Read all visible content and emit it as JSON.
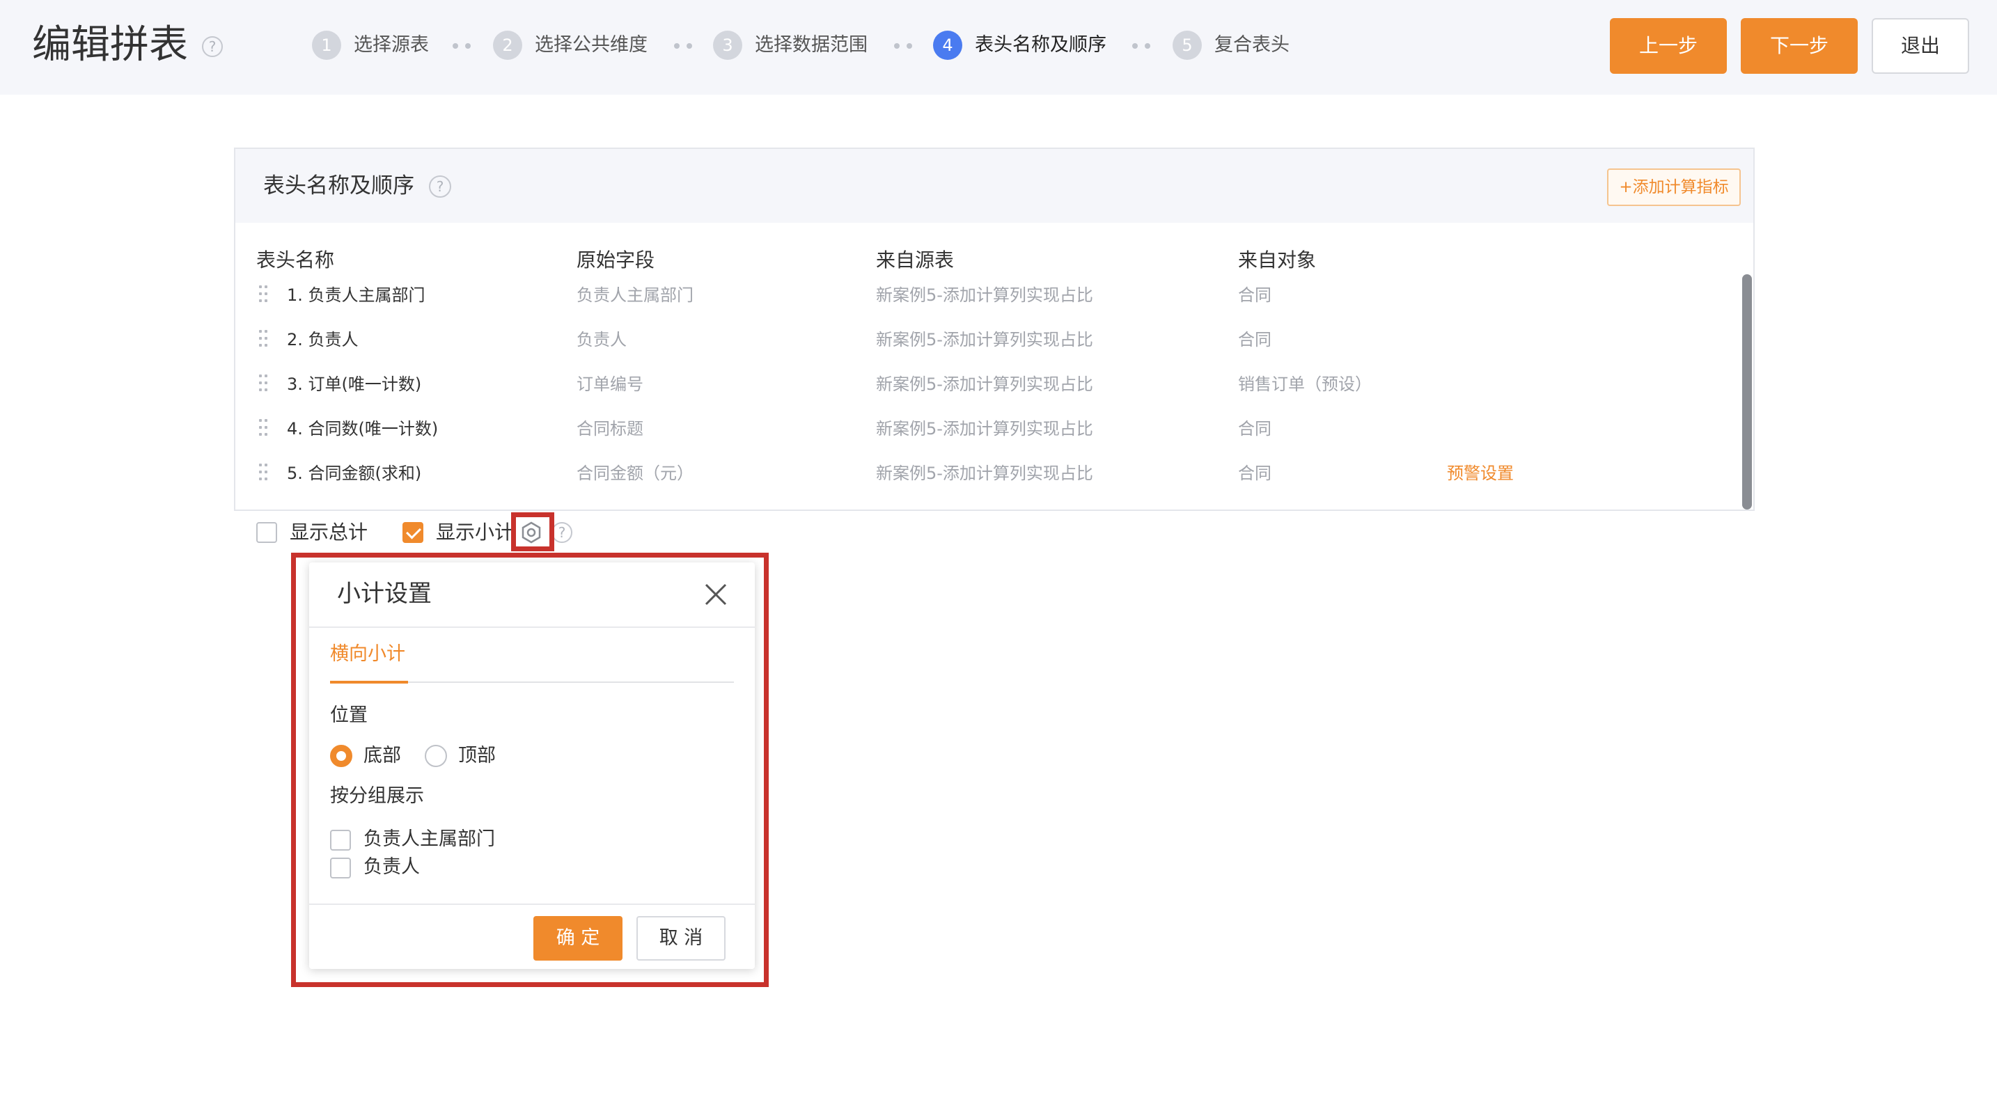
{
  "header": {
    "title": "编辑拼表",
    "help_icon": "?",
    "steps": [
      {
        "num": "1",
        "label": "选择源表",
        "active": false
      },
      {
        "num": "2",
        "label": "选择公共维度",
        "active": false
      },
      {
        "num": "3",
        "label": "选择数据范围",
        "active": false
      },
      {
        "num": "4",
        "label": "表头名称及顺序",
        "active": true
      },
      {
        "num": "5",
        "label": "复合表头",
        "active": false
      }
    ],
    "prev_label": "上一步",
    "next_label": "下一步",
    "exit_label": "退出"
  },
  "card": {
    "title": "表头名称及顺序",
    "help_icon": "?",
    "add_metric_label": "+添加计算指标",
    "columns": [
      "表头名称",
      "原始字段",
      "来自源表",
      "来自对象"
    ],
    "rows": [
      {
        "name": "1. 负责人主属部门",
        "field": "负责人主属部门",
        "source": "新案例5-添加计算列实现占比",
        "object": "合同",
        "action": ""
      },
      {
        "name": "2. 负责人",
        "field": "负责人",
        "source": "新案例5-添加计算列实现占比",
        "object": "合同",
        "action": ""
      },
      {
        "name": "3. 订单(唯一计数)",
        "field": "订单编号",
        "source": "新案例5-添加计算列实现占比",
        "object": "销售订单（预设）",
        "action": ""
      },
      {
        "name": "4. 合同数(唯一计数)",
        "field": "合同标题",
        "source": "新案例5-添加计算列实现占比",
        "object": "合同",
        "action": ""
      },
      {
        "name": "5. 合同金额(求和)",
        "field": "合同金额（元）",
        "source": "新案例5-添加计算列实现占比",
        "object": "合同",
        "action": "预警设置"
      }
    ]
  },
  "options": {
    "show_total_label": "显示总计",
    "show_total_checked": false,
    "show_subtotal_label": "显示小计",
    "show_subtotal_checked": true,
    "help_icon": "?"
  },
  "popup": {
    "title": "小计设置",
    "tab": "横向小计",
    "position_label": "位置",
    "position_options": [
      {
        "label": "底部",
        "checked": true
      },
      {
        "label": "顶部",
        "checked": false
      }
    ],
    "group_label": "按分组展示",
    "group_options": [
      {
        "label": "负责人主属部门",
        "checked": false
      },
      {
        "label": "负责人",
        "checked": false
      }
    ],
    "confirm_label": "确 定",
    "cancel_label": "取 消"
  },
  "colors": {
    "accent": "#f08a2c",
    "active_step": "#4a7bf0",
    "highlight": "#c8322c"
  }
}
